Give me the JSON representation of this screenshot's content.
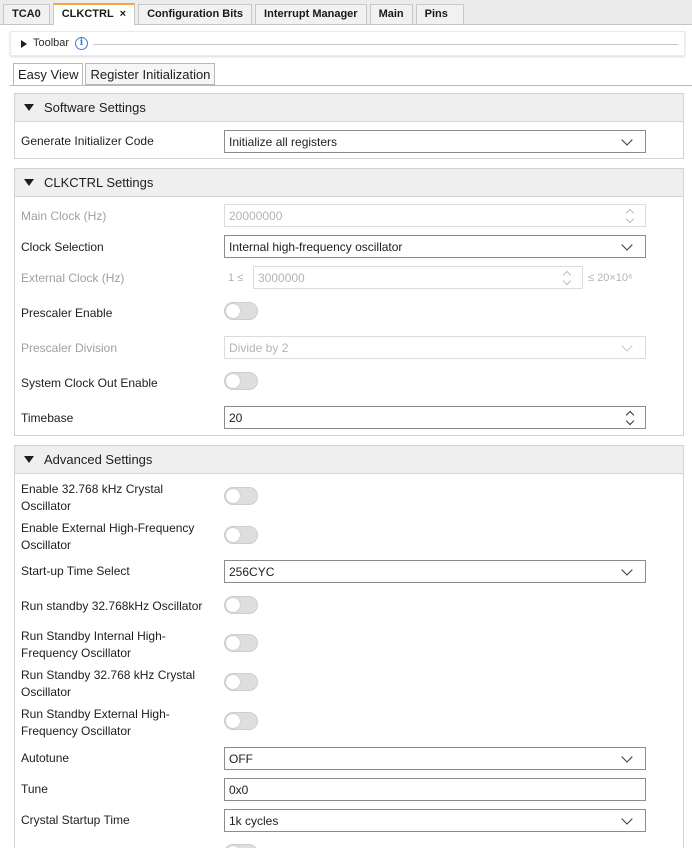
{
  "top_tabs": [
    "TCA0",
    "CLKCTRL",
    "Configuration Bits",
    "Interrupt Manager",
    "Main",
    "Pins"
  ],
  "active_tab_close": "×",
  "toolbar": {
    "label": "Toolbar",
    "info_icon": "i"
  },
  "view_tabs": [
    "Easy View",
    "Register Initialization"
  ],
  "software": {
    "title": "Software Settings",
    "generate_label": "Generate Initializer Code",
    "generate_value": "Initialize all registers"
  },
  "clkctrl": {
    "title": "CLKCTRL Settings",
    "main_clock_label": "Main Clock (Hz)",
    "main_clock_value": "20000000",
    "clock_selection_label": "Clock Selection",
    "clock_selection_value": "Internal high-frequency oscillator",
    "external_clock_label": "External Clock (Hz)",
    "external_min": "1 ≤",
    "external_value": "3000000",
    "external_max": "≤ 20×10⁶",
    "prescaler_enable_label": "Prescaler Enable",
    "prescaler_division_label": "Prescaler Division",
    "prescaler_division_value": "Divide by 2",
    "clock_out_label": "System Clock Out Enable",
    "timebase_label": "Timebase",
    "timebase_value": "20"
  },
  "advanced": {
    "title": "Advanced Settings",
    "xosc32k_label": "Enable 32.768 kHz Crystal Oscillator",
    "xosc_hf_label": "Enable External High-Frequency Oscillator",
    "startup_label": "Start-up Time Select",
    "startup_value": "256CYC",
    "run_standby_32k_label": "Run standby 32.768kHz Oscillator",
    "run_standby_int_hf_label": "Run Standby Internal High-Frequency Oscillator",
    "run_standby_32k_crystal_label": "Run Standby 32.768 kHz Crystal Oscillator",
    "run_standby_ext_hf_label": "Run Standby External High-Frequency Oscillator",
    "autotune_label": "Autotune",
    "autotune_value": "OFF",
    "tune_label": "Tune",
    "tune_value": "0x0",
    "crystal_startup_label": "Crystal Startup Time",
    "crystal_startup_value": "1k cycles"
  },
  "toggles": {
    "prescaler_enable": false,
    "clock_out_enable": false,
    "xosc32k": false,
    "xosc_hf": false,
    "run_standby_32k": false,
    "run_standby_int_hf": false,
    "run_standby_32k_crystal": false,
    "run_standby_ext_hf": false
  },
  "colors": {
    "active_tab_accent": "#f3a43b",
    "info_icon": "#3b7fd1",
    "section_header": "#efefef"
  }
}
